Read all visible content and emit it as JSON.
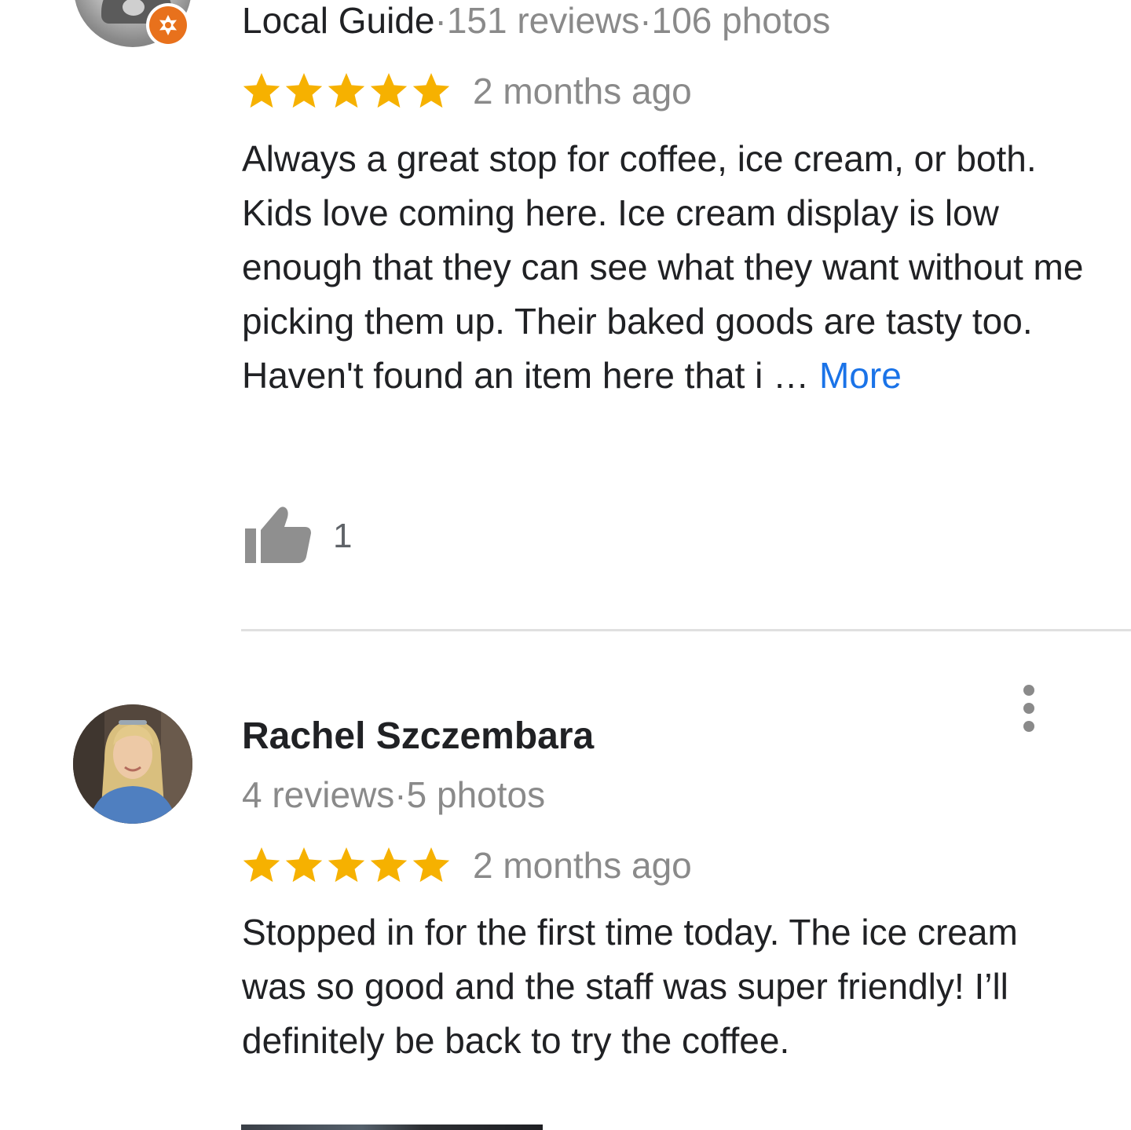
{
  "review1": {
    "author_badge": "Local Guide",
    "separator1": "·",
    "reviews_count": "151 reviews",
    "separator2": "·",
    "photos_count": "106 photos",
    "rating": 5,
    "date": "2 months ago",
    "text": "Always a great stop for coffee, ice cream, or both. Kids love coming here. Ice cream display is low enough that they can see what they want without me picking them up. Their baked goods are tasty too. Haven't found an item here that i … ",
    "more_label": "More",
    "like_count": "1"
  },
  "review2": {
    "author_name": "Rachel Szczembara",
    "reviews_count": "4 reviews",
    "separator": "·",
    "photos_count": "5 photos",
    "rating": 5,
    "date": "2 months ago",
    "text": "Stopped in for the first time today. The ice cream was so good and the staff was super friendly! I’ll definitely be back to try the coffee."
  },
  "colors": {
    "star": "#f6b100",
    "link": "#1a73e8",
    "secondary_text": "#8a8a8a",
    "primary_text": "#202124",
    "local_guide_badge": "#e8711c",
    "divider": "#e0e0e0"
  },
  "icons": {
    "star": "star-icon",
    "thumbs_up": "thumbs-up-icon",
    "more_options": "more-vert-icon",
    "local_guide": "local-guide-badge-icon"
  }
}
